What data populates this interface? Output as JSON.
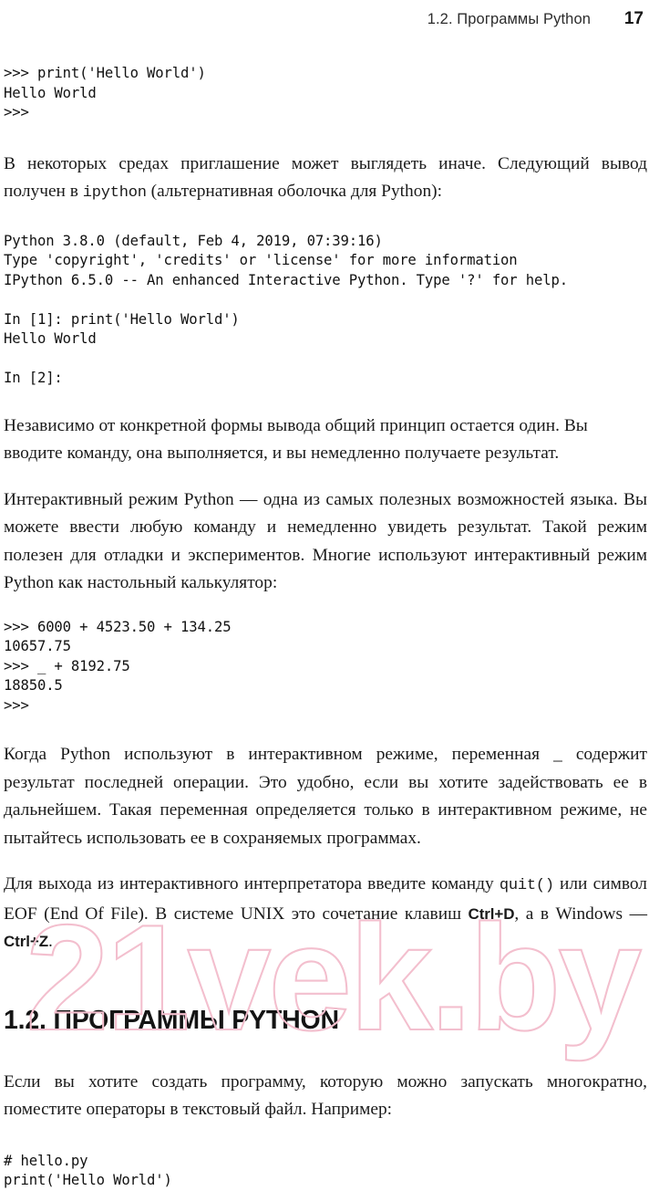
{
  "header": {
    "title": "1.2. Программы Python",
    "page_number": "17"
  },
  "blocks": {
    "code_1": ">>> print('Hello World')\nHello World\n>>>",
    "para_1_a": "В некоторых средах приглашение может выглядеть иначе. Следующий вывод получен в ",
    "para_1_mono": "ipython",
    "para_1_b": " (альтернативная оболочка для Python):",
    "code_2": "Python 3.8.0 (default, Feb 4, 2019, 07:39:16)\nType 'copyright', 'credits' or 'license' for more information\nIPython 6.5.0 -- An enhanced Interactive Python. Type '?' for help.\n\nIn [1]: print('Hello World')\nHello World\n\nIn [2]:",
    "para_2": "Независимо от конкретной формы вывода общий принцип остается один. Вы вводите команду, она выполняется, и вы немедленно получаете результат.",
    "para_3": "Интерактивный режим Python — одна из самых полезных возможностей языка. Вы можете ввести любую команду и немедленно увидеть результат. Такой режим полезен для отладки и экспериментов. Многие используют интерактивный режим Python как настольный калькулятор:",
    "code_3": ">>> 6000 + 4523.50 + 134.25\n10657.75\n>>> _ + 8192.75\n18850.5\n>>>",
    "para_4": "Когда Python используют в интерактивном режиме, переменная _ содержит результат последней операции. Это удобно, если вы хотите задействовать ее в дальнейшем. Такая переменная определяется только в интерактивном режиме, не пытайтесь использовать ее в сохраняемых программах.",
    "para_5_a": "Для выхода из интерактивного интерпретатора введите команду ",
    "para_5_mono_1": "quit()",
    "para_5_b": " или символ EOF (End Of File). В системе UNIX это сочетание клавиш ",
    "para_5_kbd_1": "Ctrl+D",
    "para_5_c": ", а в Windows — ",
    "para_5_kbd_2": "Ctrl+Z",
    "para_5_d": ".",
    "section_heading": "1.2. ПРОГРАММЫ PYTHON",
    "para_6": "Если вы хотите создать программу, которую можно запускать многократно, поместите операторы в текстовый файл. Например:",
    "code_4": "# hello.py\nprint('Hello World')"
  },
  "watermark": {
    "text": "21vek.by",
    "color": "#f3bfce"
  }
}
